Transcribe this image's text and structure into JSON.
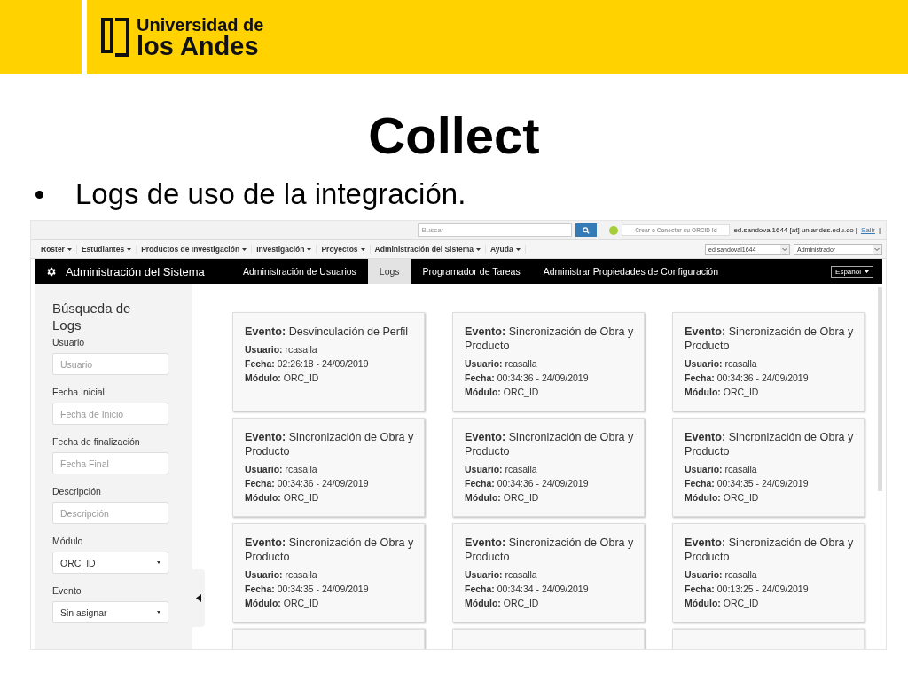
{
  "header": {
    "logo_line1": "Universidad de",
    "logo_line2": "los Andes"
  },
  "title": "Collect",
  "bullets": [
    "Logs de uso de la integración."
  ],
  "screen": {
    "top_bar": {
      "search_placeholder": "Buscar",
      "orcid_button": "Crear o Conectar su ORCID Id",
      "user_email": "ed.sandoval1644 [at] uniandes.edu.co |",
      "logout_link": "Salir",
      "trailing": "|"
    },
    "menu": [
      {
        "label": "Roster"
      },
      {
        "label": "Estudiantes"
      },
      {
        "label": "Productos de Investigación"
      },
      {
        "label": "Investigación"
      },
      {
        "label": "Proyectos"
      },
      {
        "label": "Administración del Sistema"
      },
      {
        "label": "Ayuda"
      }
    ],
    "menu_selects": [
      "ed.sandoval1644",
      "Administrador"
    ],
    "admin_bar": {
      "title": "Administración del Sistema",
      "language": "Español"
    },
    "tabs": [
      {
        "label": "Administración de Usuarios",
        "selected": false
      },
      {
        "label": "Logs",
        "selected": true
      },
      {
        "label": "Programador de Tareas",
        "selected": false
      },
      {
        "label": "Administrar Propiedades de Configuración",
        "selected": false
      }
    ],
    "sidebar": {
      "heading": "Búsqueda de Logs",
      "fields": [
        {
          "kind": "text",
          "label": "Usuario",
          "placeholder": "Usuario"
        },
        {
          "kind": "text",
          "label": "Fecha Inicial",
          "placeholder": "Fecha de Inicio"
        },
        {
          "kind": "text",
          "label": "Fecha de finalización",
          "placeholder": "Fecha Final"
        },
        {
          "kind": "text",
          "label": "Descripción",
          "placeholder": "Descripción"
        },
        {
          "kind": "select",
          "label": "Módulo",
          "value": "ORC_ID"
        },
        {
          "kind": "select",
          "label": "Evento",
          "value": "Sin asignar"
        }
      ]
    },
    "cards": [
      {
        "kind": "log",
        "event_label": "Evento:",
        "event": "Desvinculación de Perfil",
        "user_label": "Usuario:",
        "user": "rcasalla",
        "date_label": "Fecha:",
        "date": "02:26:18 - 24/09/2019",
        "module_label": "Módulo:",
        "module": "ORC_ID"
      },
      {
        "kind": "log",
        "event_label": "Evento:",
        "event": "Sincronización de Obra y Producto",
        "user_label": "Usuario:",
        "user": "rcasalla",
        "date_label": "Fecha:",
        "date": "00:34:36 - 24/09/2019",
        "module_label": "Módulo:",
        "module": "ORC_ID"
      },
      {
        "kind": "log",
        "event_label": "Evento:",
        "event": "Sincronización de Obra y Producto",
        "user_label": "Usuario:",
        "user": "rcasalla",
        "date_label": "Fecha:",
        "date": "00:34:36 - 24/09/2019",
        "module_label": "Módulo:",
        "module": "ORC_ID"
      },
      {
        "kind": "log",
        "event_label": "Evento:",
        "event": "Sincronización de Obra y Producto",
        "user_label": "Usuario:",
        "user": "rcasalla",
        "date_label": "Fecha:",
        "date": "00:34:36 - 24/09/2019",
        "module_label": "Módulo:",
        "module": "ORC_ID"
      },
      {
        "kind": "log",
        "event_label": "Evento:",
        "event": "Sincronización de Obra y Producto",
        "user_label": "Usuario:",
        "user": "rcasalla",
        "date_label": "Fecha:",
        "date": "00:34:36 - 24/09/2019",
        "module_label": "Módulo:",
        "module": "ORC_ID"
      },
      {
        "kind": "log",
        "event_label": "Evento:",
        "event": "Sincronización de Obra y Producto",
        "user_label": "Usuario:",
        "user": "rcasalla",
        "date_label": "Fecha:",
        "date": "00:34:35 - 24/09/2019",
        "module_label": "Módulo:",
        "module": "ORC_ID"
      },
      {
        "kind": "log",
        "event_label": "Evento:",
        "event": "Sincronización de Obra y Producto",
        "user_label": "Usuario:",
        "user": "rcasalla",
        "date_label": "Fecha:",
        "date": "00:34:35 - 24/09/2019",
        "module_label": "Módulo:",
        "module": "ORC_ID"
      },
      {
        "kind": "log",
        "event_label": "Evento:",
        "event": "Sincronización de Obra y Producto",
        "user_label": "Usuario:",
        "user": "rcasalla",
        "date_label": "Fecha:",
        "date": "00:34:34 - 24/09/2019",
        "module_label": "Módulo:",
        "module": "ORC_ID"
      },
      {
        "kind": "log",
        "event_label": "Evento:",
        "event": "Sincronización de Obra y Producto",
        "user_label": "Usuario:",
        "user": "rcasalla",
        "date_label": "Fecha:",
        "date": "00:13:25 - 24/09/2019",
        "module_label": "Módulo:",
        "module": "ORC_ID"
      },
      {
        "kind": "cut"
      },
      {
        "kind": "cut"
      },
      {
        "kind": "cut"
      }
    ]
  }
}
